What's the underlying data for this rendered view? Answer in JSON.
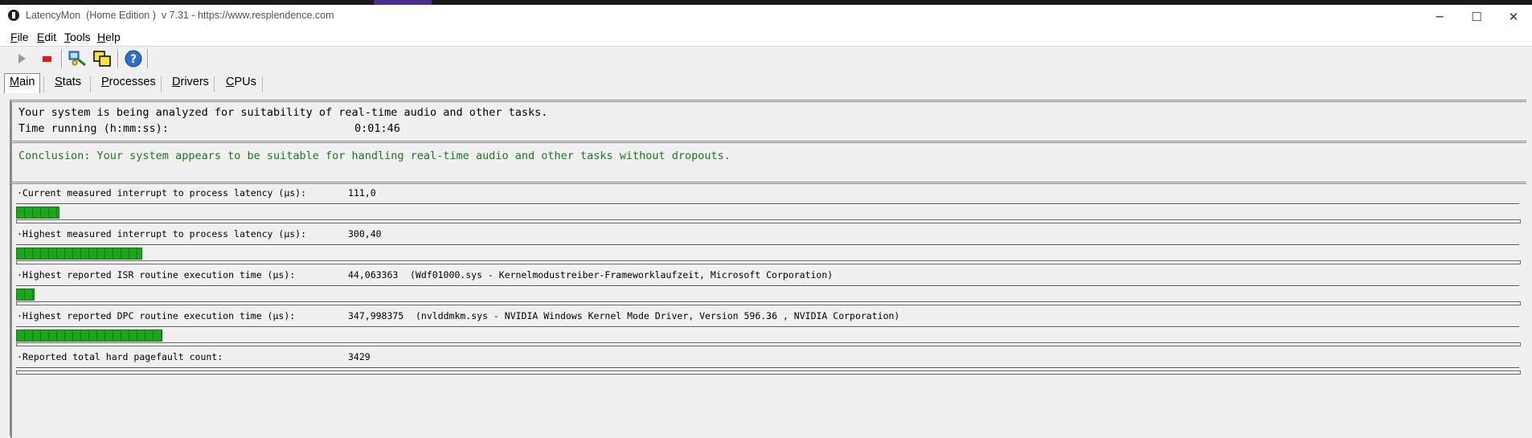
{
  "window": {
    "title": "LatencyMon  (Home Edition )  v 7.31 - https://www.resplendence.com",
    "controls": {
      "minimize": "─",
      "maximize": "☐",
      "close": "✕"
    }
  },
  "menu": [
    "File",
    "Edit",
    "Tools",
    "Help"
  ],
  "toolbar": {
    "icons": [
      "play-icon",
      "stop-icon",
      "analyze-icon",
      "windows-icon",
      "help-icon"
    ],
    "help_symbol": "?"
  },
  "tabs": [
    {
      "label": "Main",
      "active": true
    },
    {
      "label": "Stats",
      "active": false
    },
    {
      "label": "Processes",
      "active": false
    },
    {
      "label": "Drivers",
      "active": false
    },
    {
      "label": "CPUs",
      "active": false
    }
  ],
  "status": {
    "analyzing": "Your system is being analyzed for suitability of real-time audio and other tasks.",
    "time_label": "Time running (h:mm:ss):",
    "time_value": "0:01:46"
  },
  "conclusion": "Conclusion: Your system appears to be suitable for handling real-time audio and other tasks without dropouts.",
  "metrics": [
    {
      "label": "·Current measured interrupt to process latency (µs):",
      "value": "111,0",
      "detail": "",
      "bar_fraction": 0.028
    },
    {
      "label": "·Highest measured interrupt to process latency (µs):",
      "value": "300,40",
      "detail": "",
      "bar_fraction": 0.083
    },
    {
      "label": "·Highest reported ISR routine execution time (µs):",
      "value": "44,063363",
      "detail": "(Wdf01000.sys - Kernelmodustreiber-Frameworklaufzeit, Microsoft Corporation)",
      "bar_fraction": 0.011
    },
    {
      "label": "·Highest reported DPC routine execution time (µs):",
      "value": "347,998375",
      "detail": "(nvlddmkm.sys - NVIDIA Windows Kernel Mode Driver, Version 596.36 , NVIDIA Corporation)",
      "bar_fraction": 0.096
    },
    {
      "label": "·Reported total hard pagefault count:",
      "value": "3429",
      "detail": "",
      "bar_fraction": 0
    }
  ],
  "colors": {
    "bar": "#1ea51e",
    "conclusion": "#1a7a1a"
  }
}
